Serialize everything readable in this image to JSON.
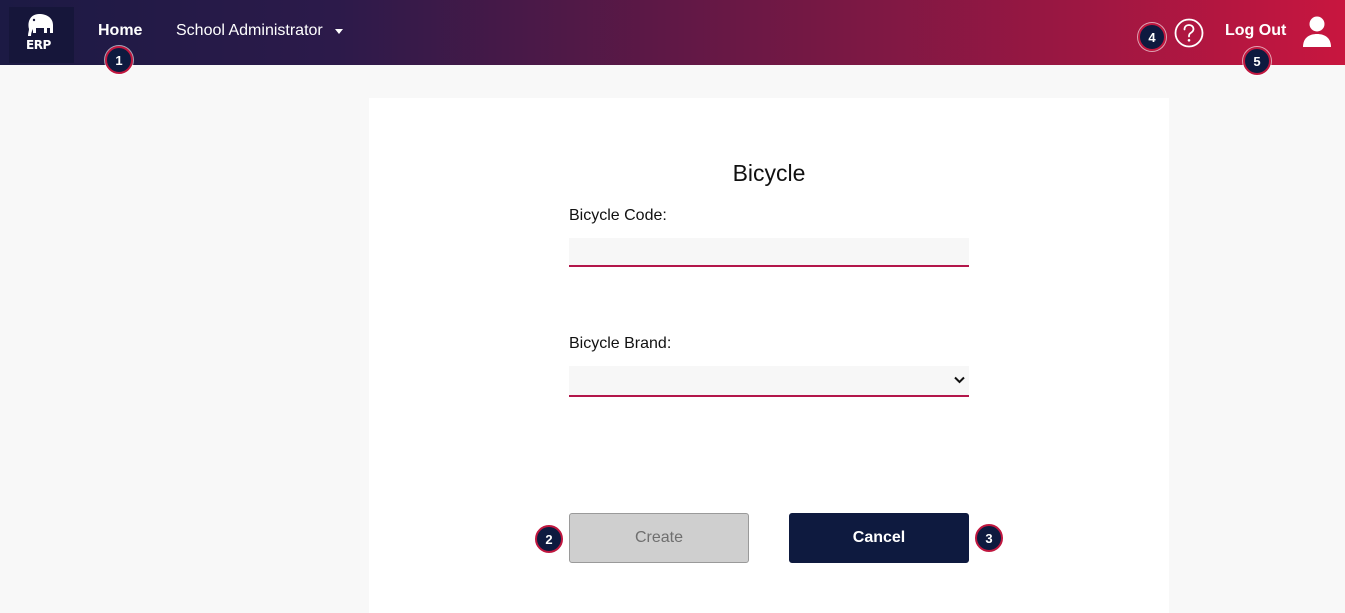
{
  "brand": {
    "logo_text": "ERP"
  },
  "nav": {
    "home_label": "Home",
    "admin_label": "School Administrator",
    "logout_label": "Log Out"
  },
  "form": {
    "title": "Bicycle",
    "code_label": "Bicycle Code:",
    "code_value": "",
    "brand_label": "Bicycle Brand:",
    "brand_selected": ""
  },
  "buttons": {
    "create_label": "Create",
    "cancel_label": "Cancel"
  },
  "markers": [
    "1",
    "2",
    "3",
    "4",
    "5"
  ],
  "icons": {
    "help": "help-icon",
    "user": "user-icon",
    "dropdown": "chevron-down-icon",
    "logo": "elephant-logo"
  },
  "colors": {
    "accent": "#b3164a",
    "primary_dark": "#0e1a3f",
    "disabled": "#cfcfcf"
  }
}
